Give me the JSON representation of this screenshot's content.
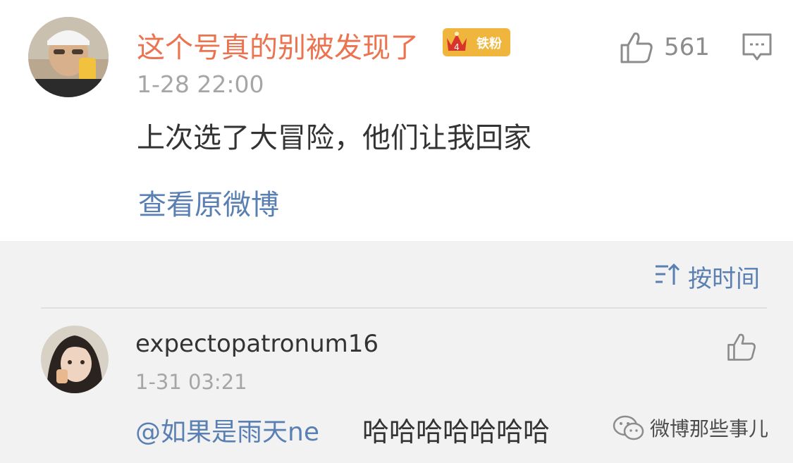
{
  "comment": {
    "username": "这个号真的别被发现了",
    "badge_label": "铁粉",
    "badge_level": "4",
    "timestamp": "1-28 22:00",
    "text": "上次选了大冒险，他们让我回家",
    "view_original_label": "查看原微博",
    "like_count": "561",
    "icons": {
      "like": "thumb-up-icon",
      "comment": "comment-icon",
      "crown": "crown-icon"
    },
    "colors": {
      "username": "#eb7350",
      "link": "#5a7fb3",
      "badge": "#f0b53c"
    }
  },
  "replies_header": {
    "sort_label": "按时间",
    "sort_icon": "sort-ascending-icon"
  },
  "reply": {
    "username": "expectopatronum16",
    "timestamp": "1-31 03:21",
    "mention": "@如果是雨天ne",
    "text": "哈哈哈哈哈哈哈",
    "like_icon": "thumb-up-icon"
  },
  "watermark": {
    "text": "微博那些事儿",
    "icon": "wechat-icon"
  }
}
